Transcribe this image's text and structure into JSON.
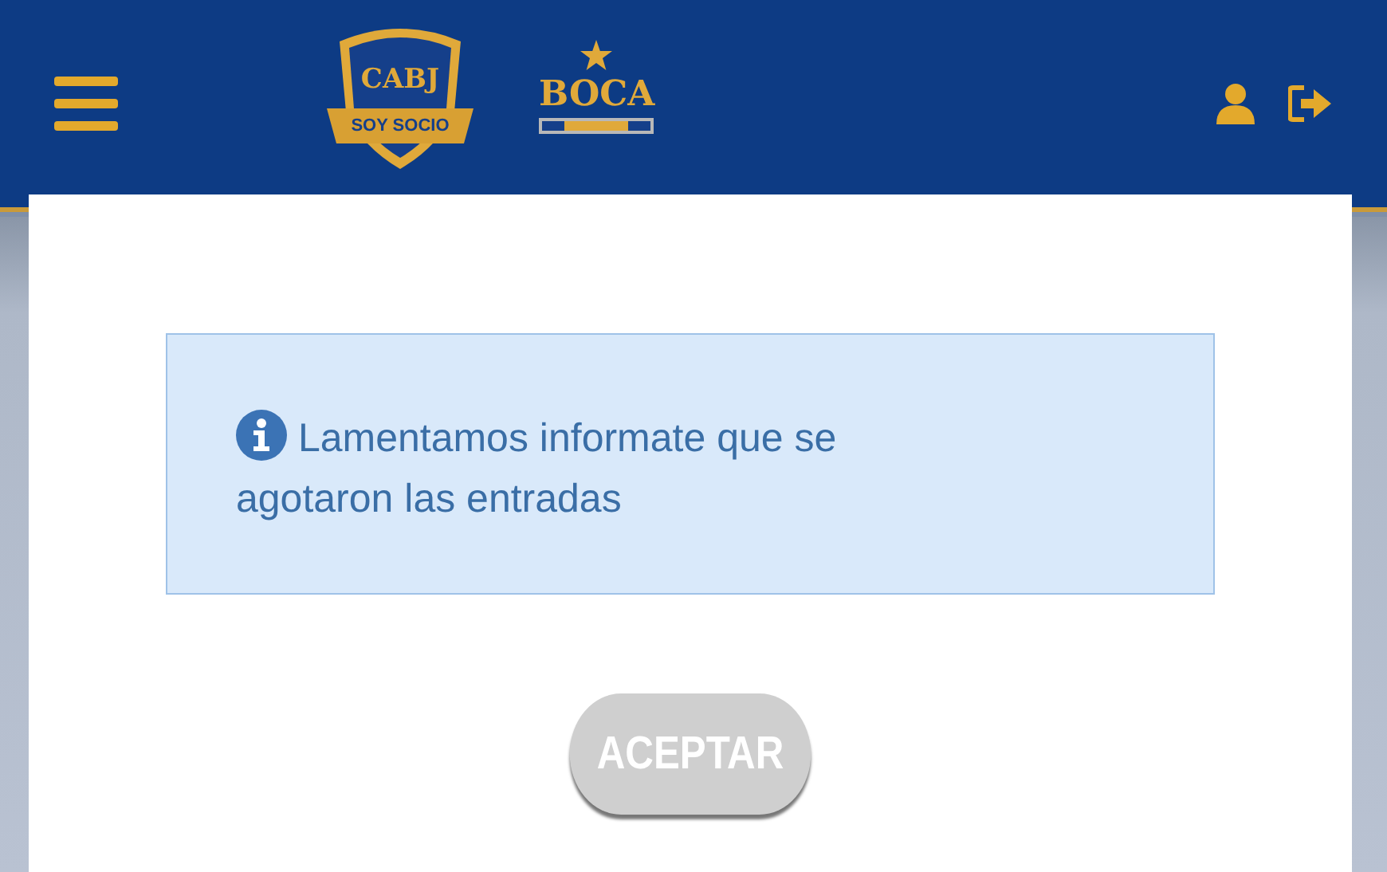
{
  "header": {
    "crest": {
      "initials": "CABJ",
      "ribbon": "SOY SOCIO"
    },
    "wordmark": "BOCA"
  },
  "dialog": {
    "message": "Lamentamos informate que se agotaron las entradas",
    "button": {
      "label": "ACEPTAR",
      "disabled": true
    }
  }
}
